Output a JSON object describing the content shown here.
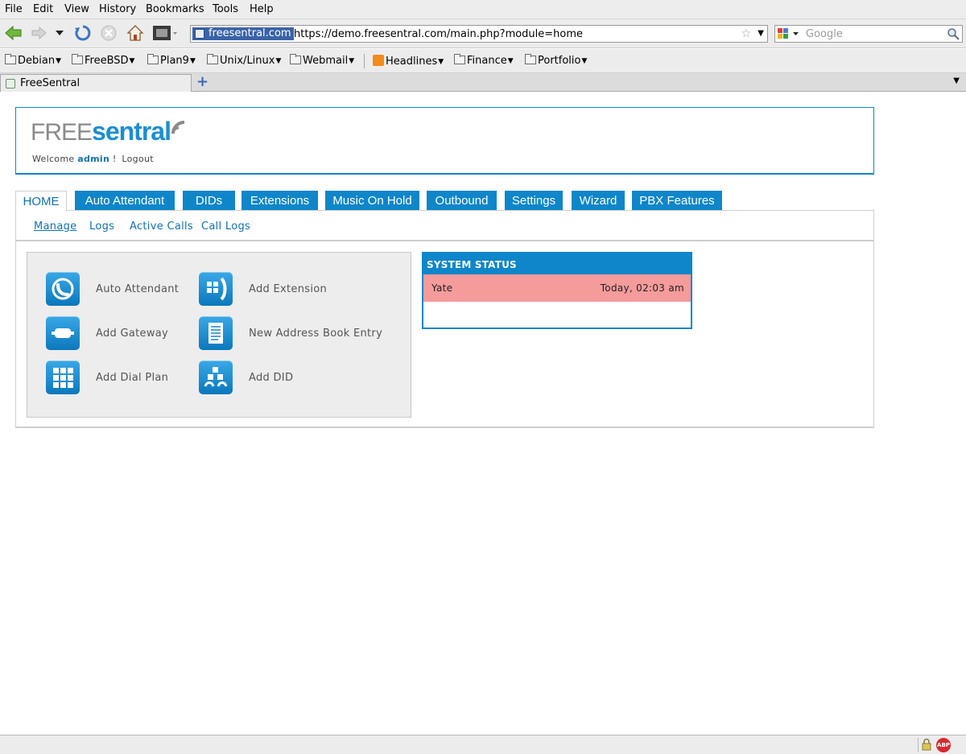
{
  "menu": [
    "File",
    "Edit",
    "View",
    "History",
    "Bookmarks",
    "Tools",
    "Help"
  ],
  "toolbar": {
    "site_identity": "freesentral.com",
    "url": "https://demo.freesentral.com/main.php?module=home",
    "search_placeholder": "Google"
  },
  "bookmarks": [
    "Debian",
    "FreeBSD",
    "Plan9",
    "Unix/Linux",
    "Webmail",
    "Headlines",
    "Finance",
    "Portfolio"
  ],
  "browser_tab": {
    "title": "FreeSentral"
  },
  "header": {
    "logo_free": "FREE",
    "logo_sentral": "sentral",
    "welcome_prefix": "Welcome",
    "username": "admin",
    "welcome_suffix": "!",
    "logout": "Logout"
  },
  "tabs": [
    "HOME",
    "Auto Attendant",
    "DIDs",
    "Extensions",
    "Music On Hold",
    "Outbound",
    "Settings",
    "Wizard",
    "PBX Features"
  ],
  "active_tab": "HOME",
  "subnav": [
    "Manage",
    "Logs",
    "Active Calls",
    "Call Logs"
  ],
  "active_subnav": "Manage",
  "quick_actions": [
    {
      "label": "Auto Attendant",
      "icon": "phone-icon"
    },
    {
      "label": "Add Extension",
      "icon": "keypad-phone-icon"
    },
    {
      "label": "Add Gateway",
      "icon": "gateway-icon"
    },
    {
      "label": "New Address Book Entry",
      "icon": "address-book-icon"
    },
    {
      "label": "Add Dial Plan",
      "icon": "dial-plan-icon"
    },
    {
      "label": "Add DID",
      "icon": "did-icon"
    }
  ],
  "system_status": {
    "title": "SYSTEM STATUS",
    "rows": [
      {
        "name": "Yate",
        "time": "Today, 02:03 am"
      }
    ],
    "row_color": "#f59b9b"
  },
  "colors": {
    "accent": "#0e86c9",
    "link": "#1071b3"
  }
}
